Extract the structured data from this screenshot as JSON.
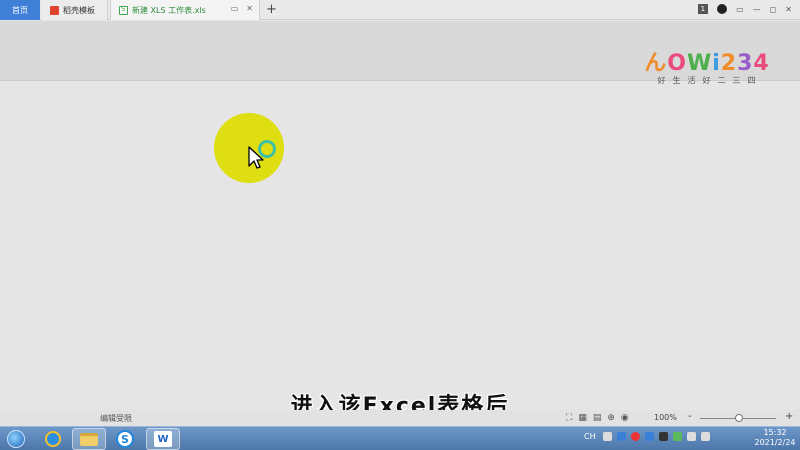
{
  "tabs": [
    {
      "label": "首页"
    },
    {
      "label": "稻壳模板"
    },
    {
      "label": "新建 XLS 工作表.xls"
    }
  ],
  "new_tab_symbol": "+",
  "window": {
    "badge": "1",
    "minimize": "▭",
    "restore": "▫",
    "close": "✕"
  },
  "logo": {
    "letters": [
      "ん",
      "O",
      "W",
      "i",
      "2",
      "3",
      "4"
    ],
    "subtitle": "好生活好二三四"
  },
  "subtitle": "进入该Excel表格后",
  "status": {
    "edit_permission": "编辑受限",
    "zoom": "100%",
    "zoom_minus": "-",
    "zoom_plus": "+"
  },
  "taskbar": {
    "sogou_letter": "S",
    "wps_letter": "W",
    "lang": "CH"
  },
  "clock": {
    "time": "15:32",
    "date": "2021/2/24"
  },
  "colors": {
    "tab_active": "#3f7fd6",
    "highlight": "#dede12",
    "cursor_ring": "#3fbfa3",
    "taskbar": "#5a83b8"
  }
}
